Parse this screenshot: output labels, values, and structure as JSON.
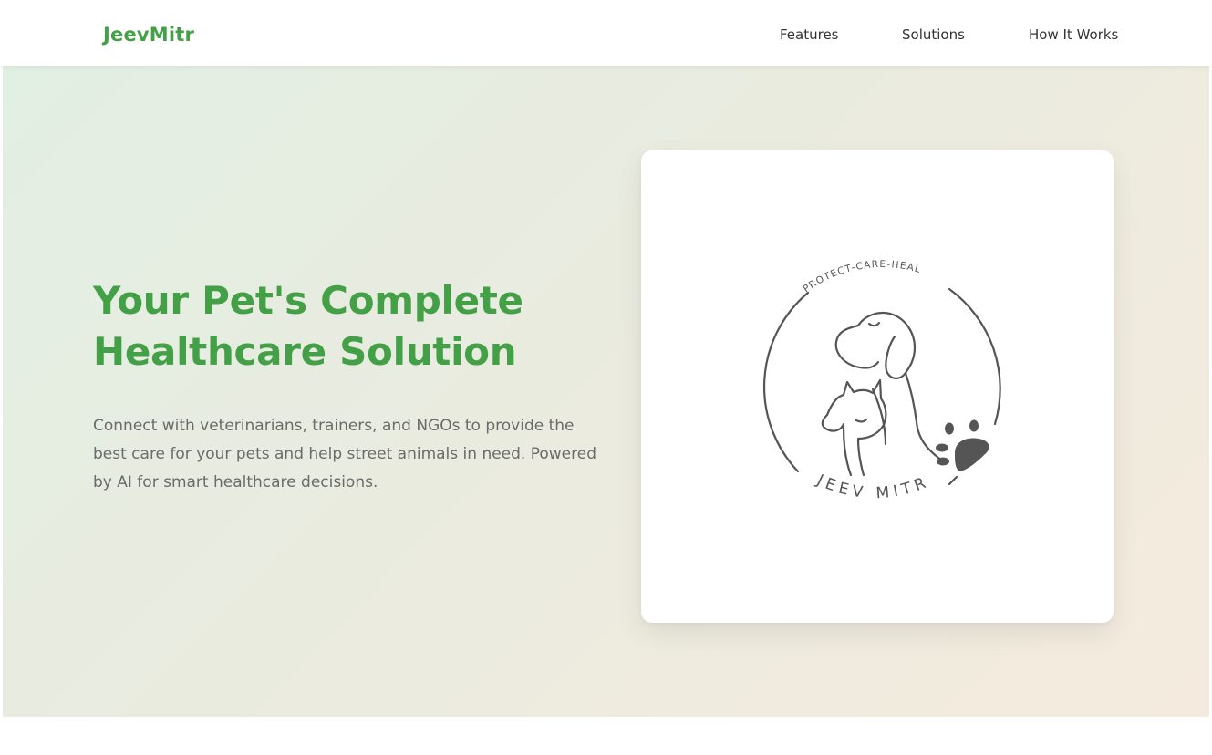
{
  "navbar": {
    "brand": "JeevMitr",
    "links": [
      "Features",
      "Solutions",
      "How It Works"
    ]
  },
  "hero": {
    "title_line1": "Your Pet's Complete",
    "title_line2": "Healthcare Solution",
    "description": "Connect with veterinarians, trainers, and NGOs to provide the best care for your pets and help street animals in need. Powered by AI for smart healthcare decisions."
  },
  "logo": {
    "tagline": "PROTECT-CARE-HEAL",
    "wordmark": "JEEV MITR"
  },
  "colors": {
    "brand_green": "#43a047",
    "nav_text": "#333333",
    "body_text": "#6b6b6b",
    "logo_ink": "#555555"
  }
}
